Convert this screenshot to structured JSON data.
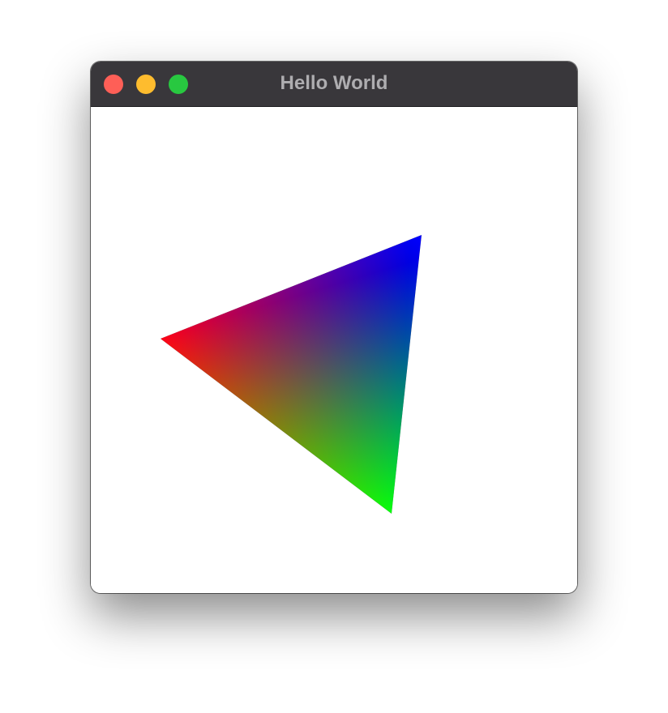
{
  "window": {
    "title": "Hello World"
  },
  "traffic_lights": {
    "close": {
      "icon": "close-button-icon",
      "color": "#fe5f57"
    },
    "minimize": {
      "icon": "minimize-button-icon",
      "color": "#febc2e"
    },
    "zoom": {
      "icon": "zoom-button-icon",
      "color": "#28c840"
    }
  },
  "colors": {
    "titlebar": "#39373b",
    "title_text": "#aeadb0",
    "canvas_background": "#ffffff"
  },
  "triangle": {
    "vertex_colors": [
      "#ff0000",
      "#0000ff",
      "#00ff00"
    ]
  }
}
